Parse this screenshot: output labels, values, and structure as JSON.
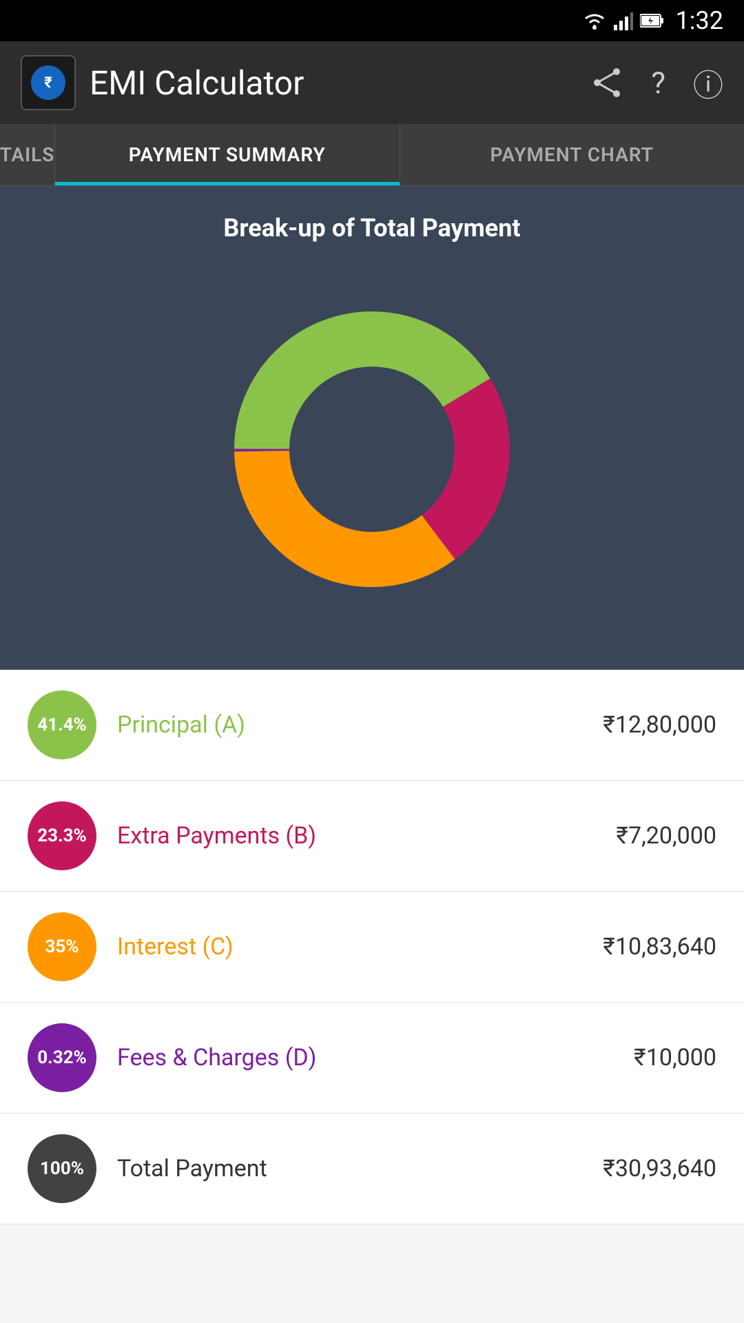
{
  "statusBar": {
    "time": "1:32",
    "wifiIcon": "wifi",
    "batteryIcon": "battery"
  },
  "appBar": {
    "title": "EMI Calculator",
    "logoSymbol": "₹",
    "shareIcon": "share",
    "helpIcon": "?",
    "infoIcon": "ⓘ"
  },
  "tabs": [
    {
      "id": "details",
      "label": "TAILS",
      "active": false,
      "partial": true
    },
    {
      "id": "summary",
      "label": "PAYMENT SUMMARY",
      "active": true,
      "partial": false
    },
    {
      "id": "chart",
      "label": "PAYMENT CHART",
      "active": false,
      "partial": false
    }
  ],
  "chartSection": {
    "title": "Break-up of Total Payment",
    "donut": {
      "segments": [
        {
          "label": "Principal",
          "percent": 41.4,
          "color": "#8BC34A",
          "startAngle": 2,
          "endAngle": 151
        },
        {
          "label": "Extra Payments",
          "percent": 23.3,
          "color": "#C2185B",
          "startAngle": 151,
          "endAngle": 235
        },
        {
          "label": "Interest",
          "percent": 35,
          "color": "#FF9800",
          "startAngle": 235,
          "endAngle": 361
        },
        {
          "label": "Fees",
          "percent": 0.32,
          "color": "#7B1FA2",
          "startAngle": 361,
          "endAngle": 362
        }
      ]
    }
  },
  "legendItems": [
    {
      "id": "principal",
      "badgeColor": "badge-green",
      "labelColor": "label-green",
      "percentage": "41.4%",
      "label": "Principal (A)",
      "value": "₹12,80,000"
    },
    {
      "id": "extra-payments",
      "badgeColor": "badge-red",
      "labelColor": "label-red",
      "percentage": "23.3%",
      "label": "Extra Payments (B)",
      "value": "₹7,20,000"
    },
    {
      "id": "interest",
      "badgeColor": "badge-orange",
      "labelColor": "label-orange",
      "percentage": "35%",
      "label": "Interest (C)",
      "value": "₹10,83,640"
    },
    {
      "id": "fees",
      "badgeColor": "badge-purple",
      "labelColor": "label-purple",
      "percentage": "0.32%",
      "label": "Fees & Charges (D)",
      "value": "₹10,000"
    },
    {
      "id": "total",
      "badgeColor": "badge-dark",
      "labelColor": "label-dark",
      "percentage": "100%",
      "label": "Total Payment",
      "value": "₹30,93,640"
    }
  ]
}
